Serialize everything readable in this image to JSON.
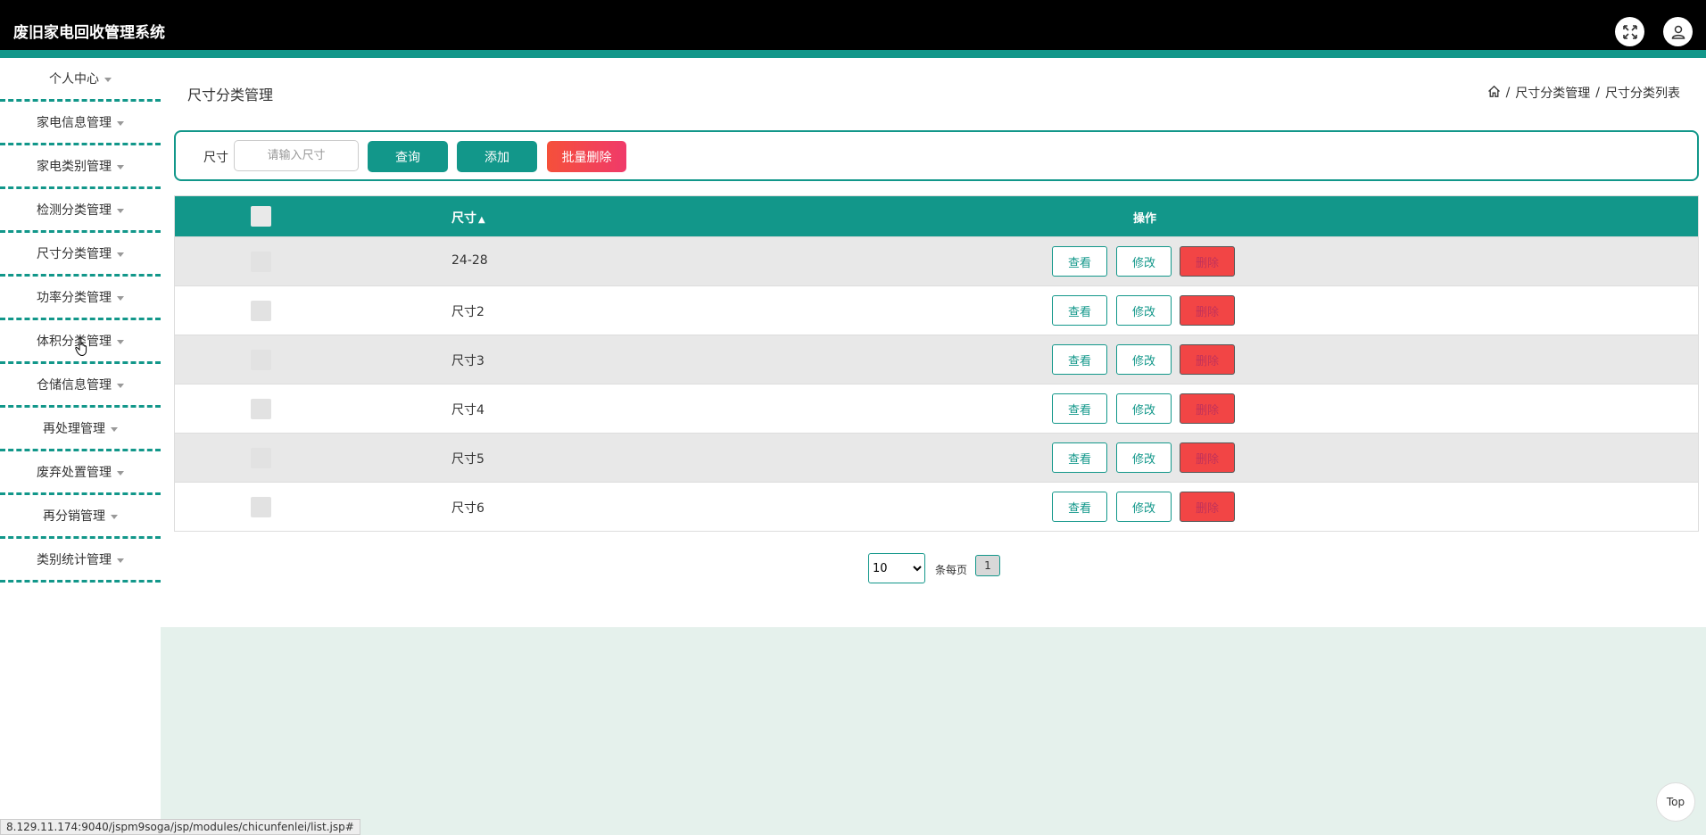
{
  "app": {
    "title": "废旧家电回收管理系统"
  },
  "header_icons": [
    "fullscreen-icon",
    "user-icon"
  ],
  "sidebar": {
    "items": [
      {
        "label": "个人中心"
      },
      {
        "label": "家电信息管理"
      },
      {
        "label": "家电类别管理"
      },
      {
        "label": "检测分类管理"
      },
      {
        "label": "尺寸分类管理"
      },
      {
        "label": "功率分类管理"
      },
      {
        "label": "体积分类管理"
      },
      {
        "label": "仓储信息管理"
      },
      {
        "label": "再处理管理"
      },
      {
        "label": "废弃处置管理"
      },
      {
        "label": "再分销管理"
      },
      {
        "label": "类别统计管理"
      }
    ]
  },
  "page": {
    "title": "尺寸分类管理",
    "breadcrumb": [
      "尺寸分类管理",
      "尺寸分类列表"
    ]
  },
  "search": {
    "label": "尺寸",
    "placeholder": "请输入尺寸",
    "query_label": "查询",
    "add_label": "添加",
    "batch_delete_label": "批量删除"
  },
  "table": {
    "headers": {
      "size": "尺寸",
      "operation": "操作"
    },
    "rows": [
      {
        "size": "24-28"
      },
      {
        "size": "尺寸2"
      },
      {
        "size": "尺寸3"
      },
      {
        "size": "尺寸4"
      },
      {
        "size": "尺寸5"
      },
      {
        "size": "尺寸6"
      }
    ],
    "actions": {
      "view": "查看",
      "edit": "修改",
      "delete": "删除"
    }
  },
  "pagination": {
    "page_size": "10",
    "per_page_label": "条每页",
    "current_page": "1"
  },
  "back_to_top": "Top",
  "status_url": "8.129.11.174:9040/jspm9soga/jsp/modules/chicunfenlei/list.jsp#",
  "colors": {
    "accent": "#12978a",
    "danger": "#f24545",
    "header": "#000000"
  }
}
